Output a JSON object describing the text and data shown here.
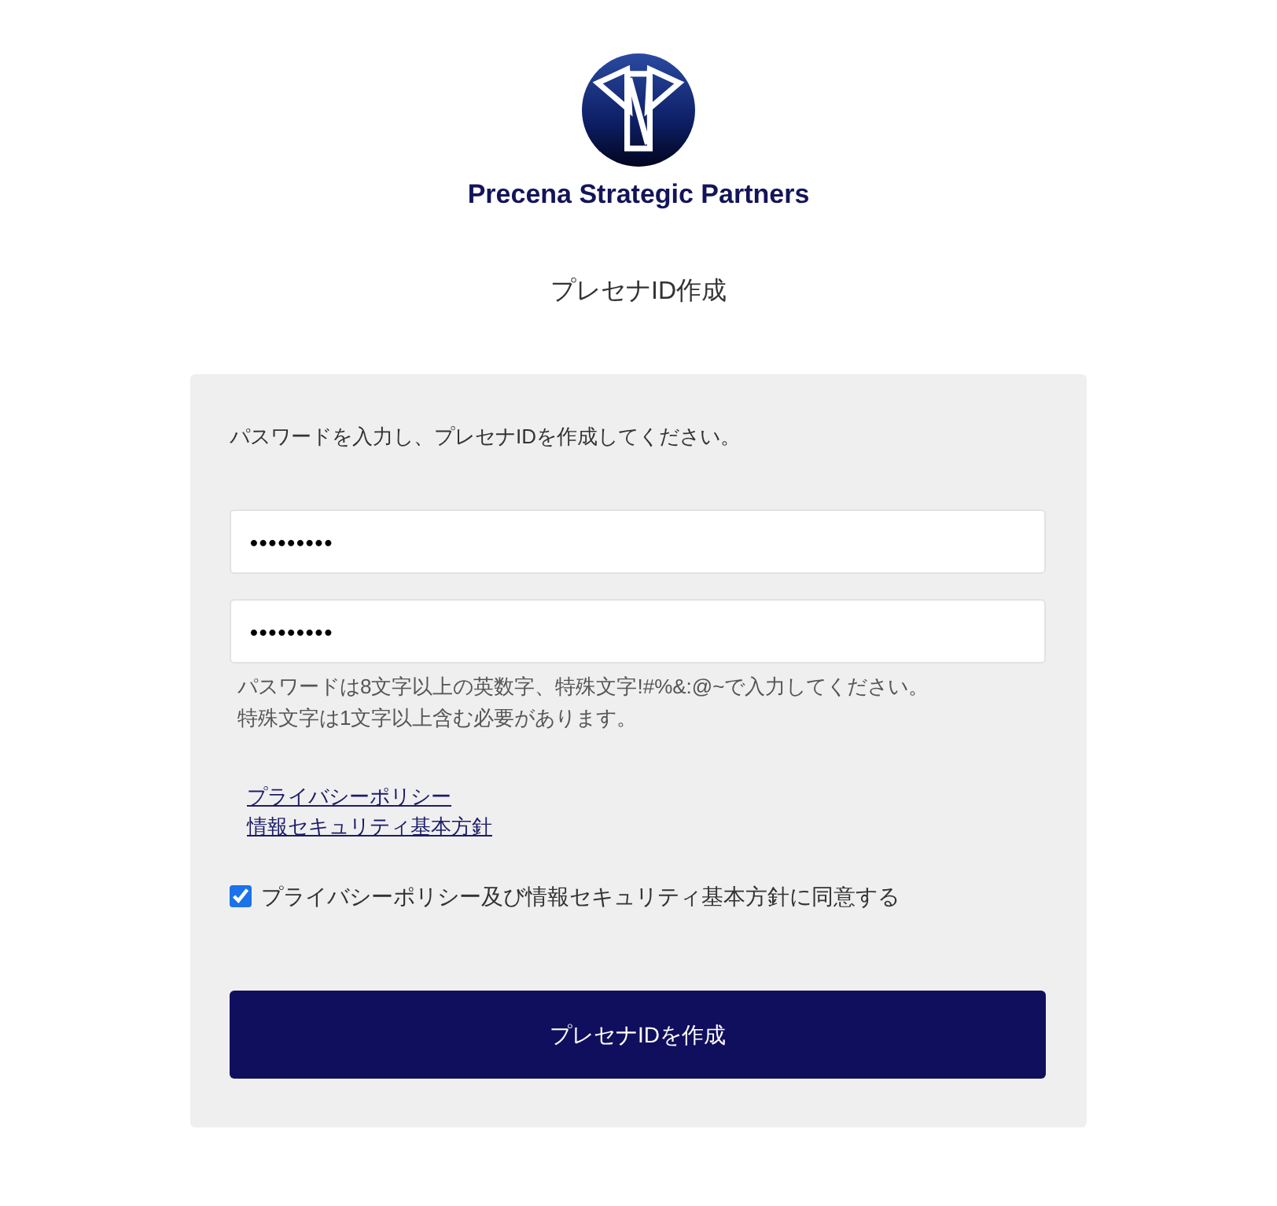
{
  "header": {
    "brand": "Precena Strategic Partners",
    "title": "プレセナID作成"
  },
  "form": {
    "instruction": "パスワードを入力し、プレセナIDを作成してください。",
    "fields": [
      {
        "kind": "password",
        "value": "•••••••••"
      },
      {
        "kind": "password",
        "value": "•••••••••"
      }
    ],
    "hint": [
      "パスワードは8文字以上の英数字、特殊文字!#%&:@~で入力してください。",
      "特殊文字は1文字以上含む必要があります。"
    ],
    "links": [
      "プライバシーポリシー",
      "情報セキュリティ基本方針"
    ],
    "agreement": {
      "label": "プライバシーポリシー及び情報セキュリティ基本方針に同意する",
      "checked": true
    },
    "submit": "プレセナIDを作成"
  }
}
